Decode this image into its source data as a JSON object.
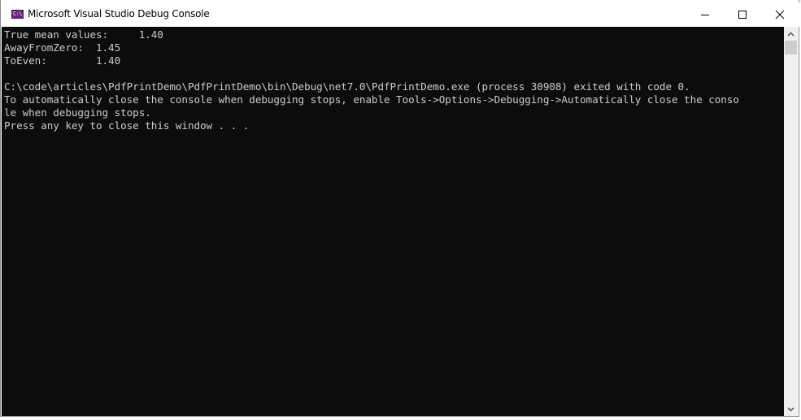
{
  "window": {
    "title": "Microsoft Visual Studio Debug Console",
    "app_icon_text": "C:\\",
    "controls": {
      "minimize": "minimize",
      "maximize": "maximize",
      "close": "close"
    }
  },
  "console": {
    "lines": [
      "True mean values:     1.40",
      "AwayFromZero:  1.45",
      "ToEven:        1.40",
      "",
      "C:\\code\\articles\\PdfPrintDemo\\PdfPrintDemo\\bin\\Debug\\net7.0\\PdfPrintDemo.exe (process 30908) exited with code 0.",
      "To automatically close the console when debugging stops, enable Tools->Options->Debugging->Automatically close the conso",
      "le when debugging stops.",
      "Press any key to close this window . . ."
    ]
  },
  "colors": {
    "console_bg": "#0c0c0c",
    "console_fg": "#cccccc",
    "icon_purple": "#68217a"
  }
}
